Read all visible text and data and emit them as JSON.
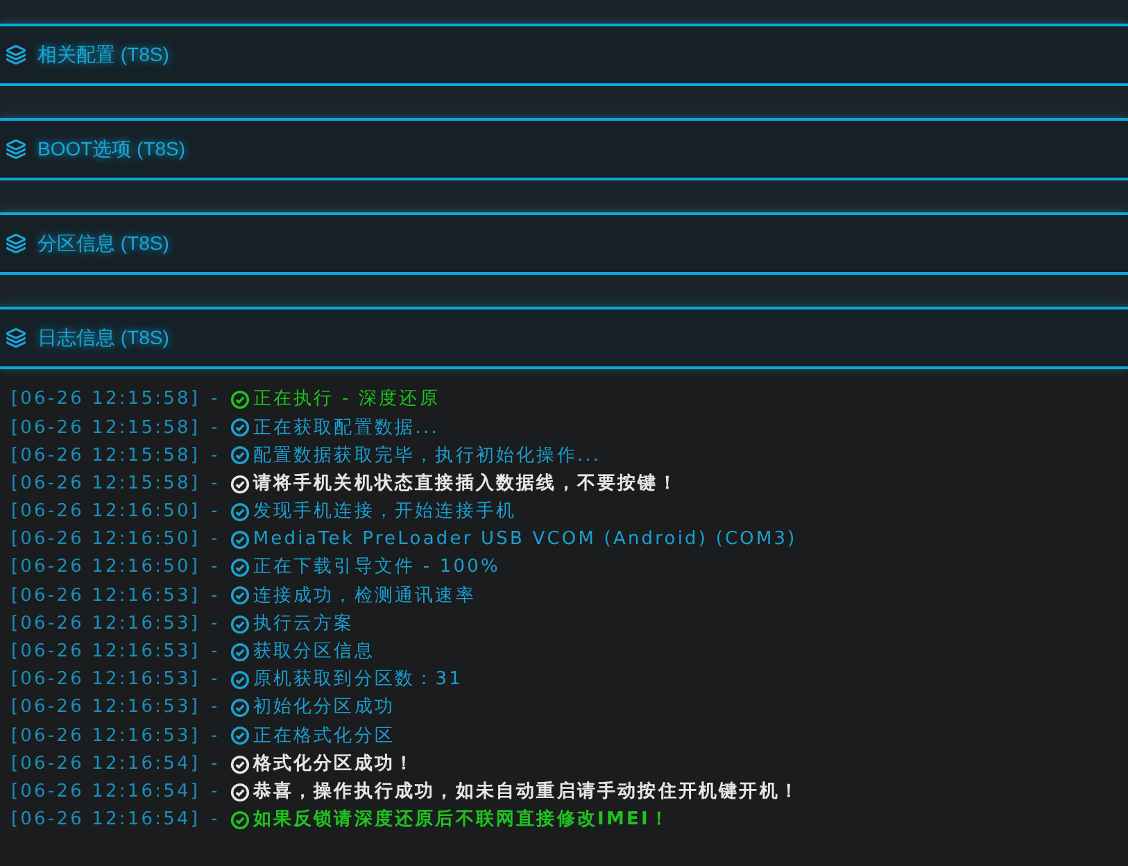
{
  "panels": [
    {
      "title": "相关配置 (T8S)"
    },
    {
      "title": "BOOT选项 (T8S)"
    },
    {
      "title": "分区信息 (T8S)"
    },
    {
      "title": "日志信息 (T8S)"
    }
  ],
  "log": [
    {
      "time": "[06-26 12:15:58]",
      "sep": "-",
      "kind": "start",
      "text": "正在执行 - 深度还原"
    },
    {
      "time": "[06-26 12:15:58]",
      "sep": "-",
      "kind": "info",
      "text": "正在获取配置数据..."
    },
    {
      "time": "[06-26 12:15:58]",
      "sep": "-",
      "kind": "info",
      "text": "配置数据获取完毕，执行初始化操作..."
    },
    {
      "time": "[06-26 12:15:58]",
      "sep": "-",
      "kind": "notice",
      "text": "请将手机关机状态直接插入数据线，不要按键！"
    },
    {
      "time": "[06-26 12:16:50]",
      "sep": "-",
      "kind": "info",
      "text": "发现手机连接，开始连接手机"
    },
    {
      "time": "[06-26 12:16:50]",
      "sep": "-",
      "kind": "info",
      "text": "MediaTek PreLoader USB VCOM (Android) (COM3)"
    },
    {
      "time": "[06-26 12:16:50]",
      "sep": "-",
      "kind": "info",
      "text": "正在下载引导文件 - 100%"
    },
    {
      "time": "[06-26 12:16:53]",
      "sep": "-",
      "kind": "info",
      "text": "连接成功，检测通讯速率"
    },
    {
      "time": "[06-26 12:16:53]",
      "sep": "-",
      "kind": "info",
      "text": "执行云方案"
    },
    {
      "time": "[06-26 12:16:53]",
      "sep": "-",
      "kind": "info",
      "text": "获取分区信息"
    },
    {
      "time": "[06-26 12:16:53]",
      "sep": "-",
      "kind": "info",
      "text": "原机获取到分区数：31"
    },
    {
      "time": "[06-26 12:16:53]",
      "sep": "-",
      "kind": "info",
      "text": "初始化分区成功"
    },
    {
      "time": "[06-26 12:16:53]",
      "sep": "-",
      "kind": "info",
      "text": "正在格式化分区"
    },
    {
      "time": "[06-26 12:16:54]",
      "sep": "-",
      "kind": "notice",
      "text": "格式化分区成功！"
    },
    {
      "time": "[06-26 12:16:54]",
      "sep": "-",
      "kind": "notice",
      "text": "恭喜，操作执行成功，如未自动重启请手动按住开机键开机！"
    },
    {
      "time": "[06-26 12:16:54]",
      "sep": "-",
      "kind": "done",
      "text": "如果反锁请深度还原后不联网直接修改IMEI！"
    }
  ]
}
